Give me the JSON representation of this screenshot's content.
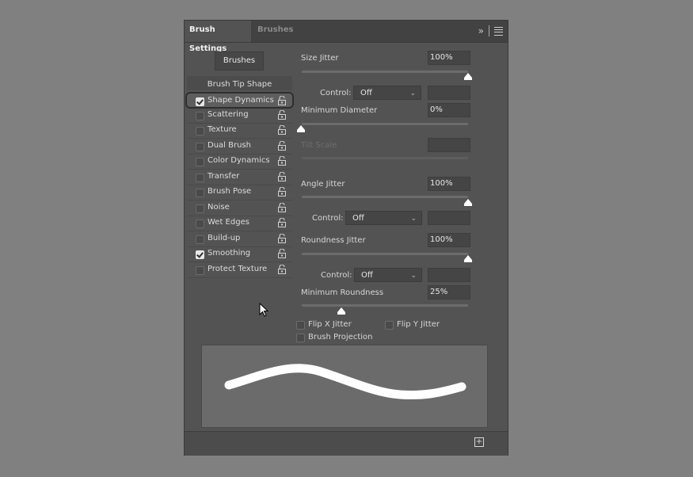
{
  "tabs": [
    {
      "label": "Brush Settings",
      "active": true
    },
    {
      "label": "Brushes",
      "active": false
    }
  ],
  "toolbar_icons": [
    "expand-panel-icon",
    "panel-menu-icon"
  ],
  "brushes_button": "Brushes",
  "brush_tip_shape": "Brush Tip Shape",
  "options": [
    {
      "label": "Shape Dynamics",
      "checked": true,
      "selected": true
    },
    {
      "label": "Scattering",
      "checked": false
    },
    {
      "label": "Texture",
      "checked": false
    },
    {
      "label": "Dual Brush",
      "checked": false
    },
    {
      "label": "Color Dynamics",
      "checked": false
    },
    {
      "label": "Transfer",
      "checked": false
    },
    {
      "label": "Brush Pose",
      "checked": false
    },
    {
      "label": "Noise",
      "checked": false
    },
    {
      "label": "Wet Edges",
      "checked": false
    },
    {
      "label": "Build-up",
      "checked": false
    },
    {
      "label": "Smoothing",
      "checked": true
    },
    {
      "label": "Protect Texture",
      "checked": false
    }
  ],
  "settings": {
    "size_jitter": {
      "label": "Size Jitter",
      "value": "100%",
      "level": 1.0
    },
    "control1": {
      "label": "Control:",
      "value": "Off"
    },
    "minimum_diameter": {
      "label": "Minimum Diameter",
      "value": "0%",
      "level": 0.0
    },
    "tilt_scale": {
      "label": "Tilt Scale",
      "value": "",
      "disabled": true
    },
    "angle_jitter": {
      "label": "Angle Jitter",
      "value": "100%",
      "level": 1.0
    },
    "control2": {
      "label": "Control:",
      "value": "Off"
    },
    "roundness_jitter": {
      "label": "Roundness Jitter",
      "value": "100%",
      "level": 1.0
    },
    "control3": {
      "label": "Control:",
      "value": "Off"
    },
    "minimum_roundness": {
      "label": "Minimum Roundness",
      "value": "25%",
      "level": 0.25
    },
    "flip_x": {
      "label": "Flip X Jitter",
      "checked": false
    },
    "flip_y": {
      "label": "Flip Y Jitter",
      "checked": false
    },
    "brush_projection": {
      "label": "Brush Projection",
      "checked": false
    }
  },
  "colors": {
    "panel": "#535353",
    "tabbar": "#424242",
    "preview": "#6b6b6b",
    "stroke": "#ffffff"
  }
}
